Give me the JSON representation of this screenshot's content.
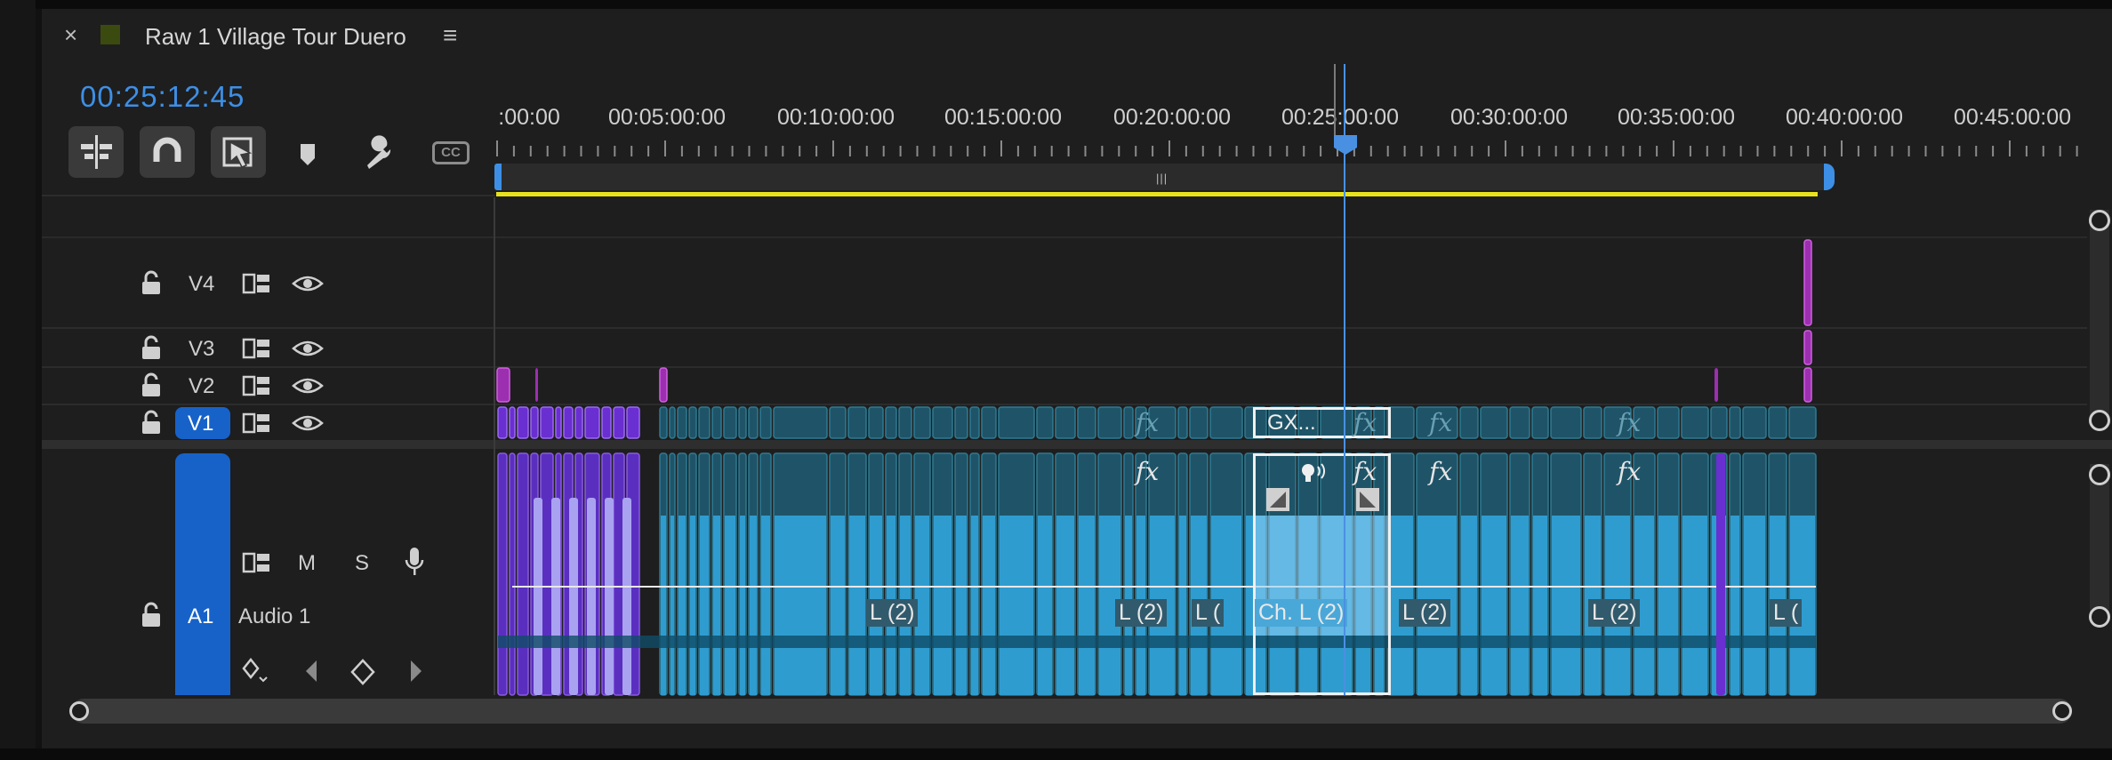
{
  "panel": {
    "title": "Raw 1 Village Tour Duero",
    "close_glyph": "×",
    "menu_glyph": "≡",
    "color_swatch": "#3b4a0f"
  },
  "timecode": "00:25:12:45",
  "toolbar": {
    "tools": [
      {
        "name": "insert-nest-icon",
        "active": true
      },
      {
        "name": "snap-magnet-icon",
        "active": true
      },
      {
        "name": "linked-selection-icon",
        "active": true
      },
      {
        "name": "add-marker-icon",
        "active": false
      },
      {
        "name": "settings-wrench-icon",
        "active": false
      },
      {
        "name": "captions-icon",
        "active": false
      }
    ],
    "cc_label": "CC"
  },
  "ruler": {
    "labels": [
      ":00:00",
      "00:05:00:00",
      "00:10:00:00",
      "00:15:00:00",
      "00:20:00:00",
      "00:25:00:00",
      "00:30:00:00",
      "00:35:00:00",
      "00:40:00:00",
      "00:45:00:00"
    ]
  },
  "tracks": {
    "video": [
      {
        "name": "V4",
        "active": false
      },
      {
        "name": "V3",
        "active": false
      },
      {
        "name": "V2",
        "active": false
      },
      {
        "name": "V1",
        "active": true
      }
    ],
    "audio": [
      {
        "name": "A1",
        "track_name": "Audio 1",
        "active": true,
        "mute": "M",
        "solo": "S"
      }
    ]
  },
  "clip_labels": {
    "selected_video": "GX...",
    "selected_audio": "Ch. L (2)",
    "audio_labels": [
      "L (2)",
      "L (2)",
      "L (",
      "L (2)",
      "L (2)",
      "L ("
    ],
    "fx": "fx"
  },
  "colors": {
    "accent_blue": "#3d8fe6",
    "track_target": "#1762c8",
    "playhead": "#4a90e2",
    "work_area": "#e8e21c",
    "video_clip": "#1f5468",
    "audio_clip": "#2f9cd0",
    "nested_clip": "#6a2fd0",
    "adjustment_clip": "#9c2fb0"
  }
}
